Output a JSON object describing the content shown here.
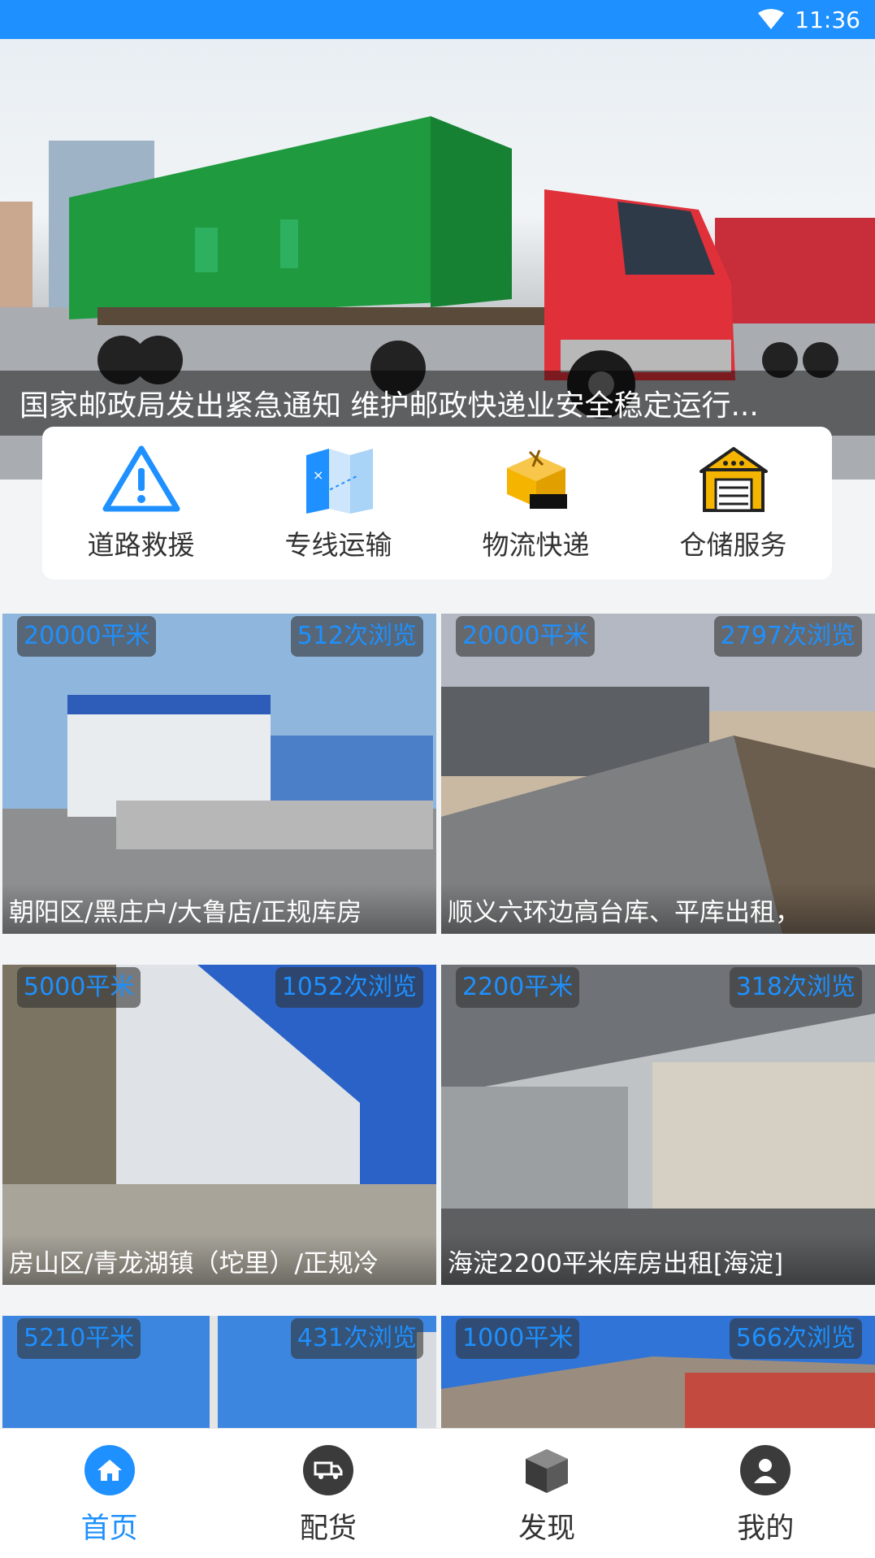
{
  "status_bar": {
    "time": "11:36"
  },
  "banner": {
    "caption": "国家邮政局发出紧急通知  维护邮政快递业安全稳定运行..."
  },
  "quick_menu": [
    {
      "label": "道路救援",
      "icon": "warning-icon"
    },
    {
      "label": "专线运输",
      "icon": "map-icon"
    },
    {
      "label": "物流快递",
      "icon": "package-icon"
    },
    {
      "label": "仓储服务",
      "icon": "warehouse-icon"
    }
  ],
  "listings": [
    {
      "area": "20000平米",
      "views": "512次浏览",
      "title": "朝阳区/黑庄户/大鲁店/正规库房"
    },
    {
      "area": "20000平米",
      "views": "2797次浏览",
      "title": "顺义六环边高台库、平库出租，"
    },
    {
      "area": "5000平米",
      "views": "1052次浏览",
      "title": "房山区/青龙湖镇（坨里）/正规冷"
    },
    {
      "area": "2200平米",
      "views": "318次浏览",
      "title": "海淀2200平米库房出租[海淀]"
    },
    {
      "area": "5210平米",
      "views": "431次浏览",
      "title": ""
    },
    {
      "area": "1000平米",
      "views": "566次浏览",
      "title": ""
    }
  ],
  "bottom_nav": [
    {
      "label": "首页",
      "icon": "home-icon",
      "active": true
    },
    {
      "label": "配货",
      "icon": "truck-icon",
      "active": false
    },
    {
      "label": "发现",
      "icon": "box-icon",
      "active": false
    },
    {
      "label": "我的",
      "icon": "user-icon",
      "active": false
    }
  ],
  "colors": {
    "accent": "#1e90ff",
    "warehouse_yellow": "#f4b400"
  }
}
